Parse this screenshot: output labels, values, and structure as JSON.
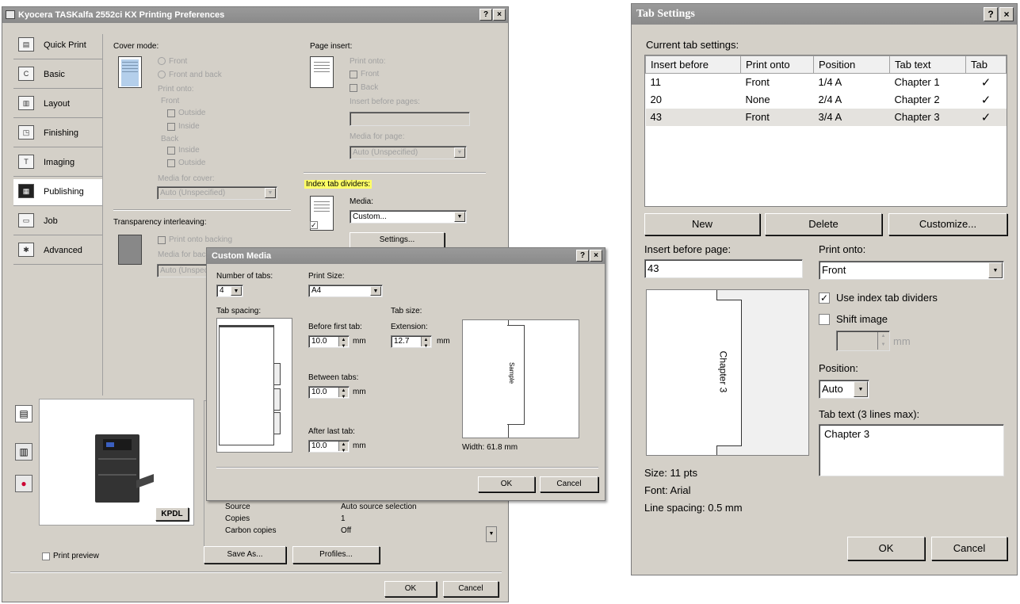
{
  "printing_prefs": {
    "title": "Kyocera TASKalfa 2552ci KX Printing Preferences",
    "help_btn": "?",
    "close_btn": "×",
    "sidebar": [
      {
        "label": "Quick Print",
        "icon": "quick-print-icon"
      },
      {
        "label": "Basic",
        "icon": "basic-icon"
      },
      {
        "label": "Layout",
        "icon": "layout-icon"
      },
      {
        "label": "Finishing",
        "icon": "finishing-icon"
      },
      {
        "label": "Imaging",
        "icon": "imaging-icon"
      },
      {
        "label": "Publishing",
        "icon": "publishing-icon",
        "active": true
      },
      {
        "label": "Job",
        "icon": "job-icon"
      },
      {
        "label": "Advanced",
        "icon": "advanced-icon"
      }
    ],
    "cover_mode": {
      "heading": "Cover mode:",
      "front": "Front",
      "front_and_back": "Front and back",
      "print_onto": "Print onto:",
      "front_label": "Front",
      "outside1": "Outside",
      "inside1": "Inside",
      "back_label": "Back",
      "inside2": "Inside",
      "outside2": "Outside",
      "media_for_cover": "Media for cover:",
      "media_value": "Auto (Unspecified)"
    },
    "transparency": {
      "heading": "Transparency interleaving:",
      "print_onto_backing": "Print onto backing",
      "media_for_backing": "Media for backing",
      "media_value": "Auto (Unspecified)"
    },
    "page_insert": {
      "heading": "Page insert:",
      "print_onto": "Print onto:",
      "front": "Front",
      "back": "Back",
      "insert_before": "Insert before pages:",
      "media_for_page": "Media for page:",
      "media_value": "Auto (Unspecified)"
    },
    "index_tab": {
      "heading": "Index tab dividers:",
      "media_label": "Media:",
      "media_value": "Custom...",
      "settings_btn": "Settings..."
    },
    "summary": [
      {
        "key": "Source",
        "value": "Auto source selection"
      },
      {
        "key": "Copies",
        "value": "1"
      },
      {
        "key": "Carbon copies",
        "value": "Off"
      }
    ],
    "badge": "KPDL",
    "print_preview": "Print preview",
    "save_as_btn": "Save As...",
    "profiles_btn": "Profiles...",
    "ok_btn": "OK",
    "cancel_btn": "Cancel"
  },
  "custom_media": {
    "title": "Custom Media",
    "help_btn": "?",
    "close_btn": "×",
    "number_of_tabs_label": "Number of tabs:",
    "number_of_tabs_value": "4",
    "print_size_label": "Print Size:",
    "print_size_value": "A4",
    "tab_spacing_label": "Tab spacing:",
    "tab_size_label": "Tab size:",
    "before_first_label": "Before first tab:",
    "before_first_value": "10.0",
    "extension_label": "Extension:",
    "extension_value": "12.7",
    "between_label": "Between tabs:",
    "between_value": "10.0",
    "after_last_label": "After last tab:",
    "after_last_value": "10.0",
    "unit": "mm",
    "sample_label": "Sample",
    "width_label": "Width: 61.8 mm",
    "ok_btn": "OK",
    "cancel_btn": "Cancel"
  },
  "tab_settings": {
    "title": "Tab Settings",
    "help_btn": "?",
    "close_btn": "×",
    "current_label": "Current tab settings:",
    "columns": [
      "Insert before",
      "Print onto",
      "Position",
      "Tab text",
      "Tab"
    ],
    "rows": [
      {
        "insert_before": "11",
        "print_onto": "Front",
        "position": "1/4 A",
        "tab_text": "Chapter 1",
        "tab": "✓"
      },
      {
        "insert_before": "20",
        "print_onto": "None",
        "position": "2/4 A",
        "tab_text": "Chapter 2",
        "tab": "✓"
      },
      {
        "insert_before": "43",
        "print_onto": "Front",
        "position": "3/4 A",
        "tab_text": "Chapter 3",
        "tab": "✓",
        "selected": true
      }
    ],
    "new_btn": "New",
    "delete_btn": "Delete",
    "customize_btn": "Customize...",
    "insert_before_label": "Insert before page:",
    "insert_before_value": "43",
    "print_onto_label": "Print onto:",
    "print_onto_value": "Front",
    "use_index_label": "Use index tab dividers",
    "use_index_checked": true,
    "shift_image_label": "Shift image",
    "shift_image_checked": false,
    "shift_unit": "mm",
    "position_label": "Position:",
    "position_value": "Auto",
    "tab_text_label": "Tab text (3 lines max):",
    "tab_text_value": "Chapter 3",
    "preview_text": "Chapter 3",
    "size_info": "Size: 11 pts",
    "font_info": "Font: Arial",
    "line_spacing_info": "Line spacing: 0.5 mm",
    "ok_btn": "OK",
    "cancel_btn": "Cancel"
  }
}
